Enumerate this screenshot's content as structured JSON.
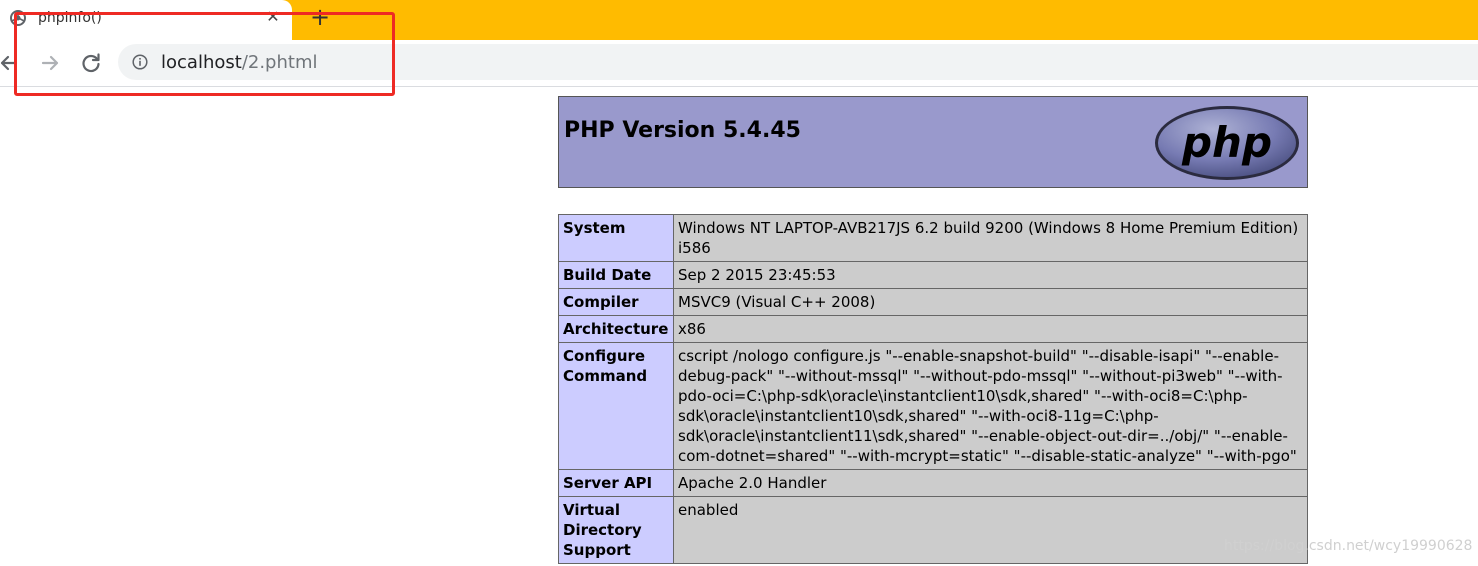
{
  "browser": {
    "tab_title": "phpinfo()",
    "close_glyph": "✕",
    "new_tab_glyph": "+",
    "url_host": "localhost",
    "url_path": "/2.phtml",
    "accent_color": "#ffbb00"
  },
  "icons": {
    "favicon": "chrome-globe-icon",
    "back": "back-arrow-icon",
    "forward": "forward-arrow-icon",
    "reload": "reload-icon",
    "info": "info-icon"
  },
  "phpinfo": {
    "title": "PHP Version 5.4.45",
    "logo_text": "php",
    "rows": [
      {
        "key": "System",
        "value": "Windows NT LAPTOP-AVB217JS 6.2 build 9200 (Windows 8 Home Premium Edition) i586"
      },
      {
        "key": "Build Date",
        "value": "Sep 2 2015 23:45:53"
      },
      {
        "key": "Compiler",
        "value": "MSVC9 (Visual C++ 2008)"
      },
      {
        "key": "Architecture",
        "value": "x86"
      },
      {
        "key": "Configure Command",
        "value": "cscript /nologo configure.js \"--enable-snapshot-build\" \"--disable-isapi\" \"--enable-debug-pack\" \"--without-mssql\" \"--without-pdo-mssql\" \"--without-pi3web\" \"--with-pdo-oci=C:\\php-sdk\\oracle\\instantclient10\\sdk,shared\" \"--with-oci8=C:\\php-sdk\\oracle\\instantclient10\\sdk,shared\" \"--with-oci8-11g=C:\\php-sdk\\oracle\\instantclient11\\sdk,shared\" \"--enable-object-out-dir=../obj/\" \"--enable-com-dotnet=shared\" \"--with-mcrypt=static\" \"--disable-static-analyze\" \"--with-pgo\""
      },
      {
        "key": "Server API",
        "value": "Apache 2.0 Handler"
      },
      {
        "key": "Virtual Directory Support",
        "value": "enabled"
      }
    ]
  },
  "watermark": "https://blog.csdn.net/wcy19990628"
}
